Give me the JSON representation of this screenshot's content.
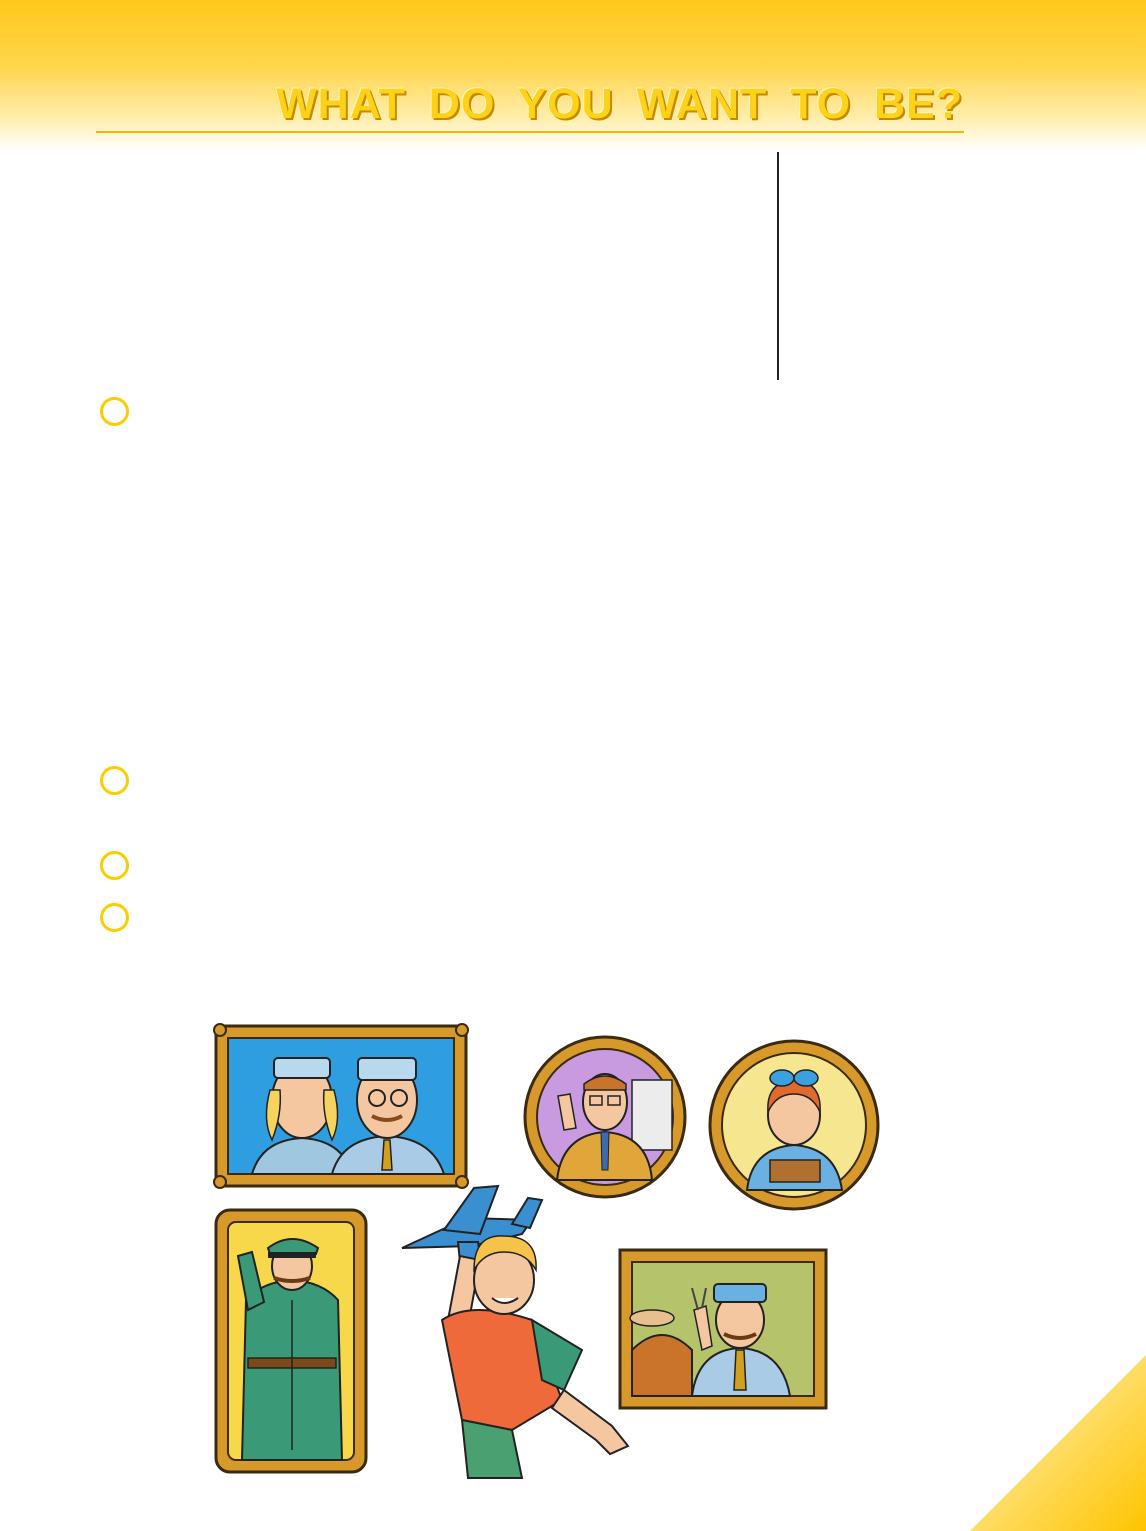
{
  "page": {
    "title": "WHAT DO YOU WANT TO BE?"
  },
  "colors": {
    "accent": "#ffcc00",
    "title_fill": "#ffd21a",
    "title_shadow": "#c58a00"
  },
  "exercises": [
    {
      "icon": "circle-bullet-icon"
    },
    {
      "icon": "circle-bullet-icon"
    },
    {
      "icon": "circle-bullet-icon"
    },
    {
      "icon": "circle-bullet-icon"
    }
  ],
  "illustration": {
    "icon": "professions-illustration",
    "portraits": [
      "doctors-portrait",
      "teacher-portrait",
      "shop-assistant-portrait",
      "officer-portrait",
      "dentist-portrait"
    ],
    "figure": "boy-with-toy-plane"
  }
}
